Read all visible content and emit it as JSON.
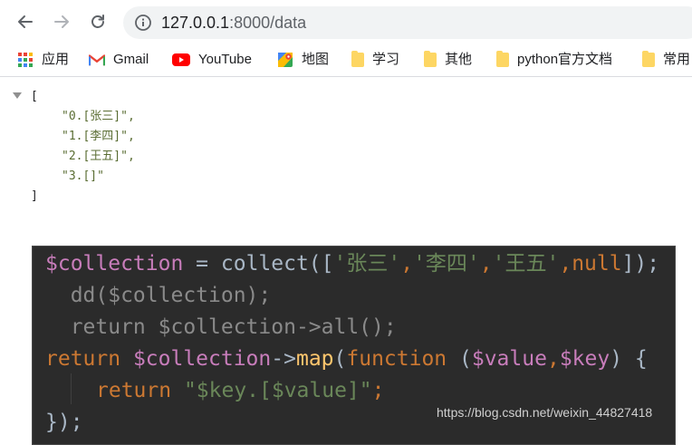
{
  "browser": {
    "url_host": "127.0.0.1",
    "url_rest": ":8000/data",
    "icons": {
      "back": "back-arrow-icon",
      "forward": "forward-arrow-icon",
      "reload": "reload-icon",
      "info": "info-icon"
    }
  },
  "bookmarks": [
    {
      "label": "应用",
      "icon": "apps-grid-icon"
    },
    {
      "label": "Gmail",
      "icon": "gmail-icon"
    },
    {
      "label": "YouTube",
      "icon": "youtube-icon"
    },
    {
      "label": "地图",
      "icon": "maps-icon"
    },
    {
      "label": "学习",
      "icon": "folder-icon"
    },
    {
      "label": "其他",
      "icon": "folder-icon"
    },
    {
      "label": "python官方文档",
      "icon": "folder-icon"
    },
    {
      "label": "常用",
      "icon": "folder-icon"
    }
  ],
  "json_view": {
    "open": "[",
    "items": [
      "\"0.[张三]\",",
      "\"1.[李四]\",",
      "\"2.[王五]\",",
      "\"3.[]\""
    ],
    "close": "]"
  },
  "code": {
    "line1": {
      "var": "$collection",
      "eq": " = ",
      "call": "collect([",
      "s1": "'张三'",
      "c1": ",",
      "s2": "'李四'",
      "c2": ",",
      "s3": "'王五'",
      "c3": ",",
      "null": "null",
      "end": "]);"
    },
    "line2": "  dd($collection);",
    "line3": "  return $collection->all();",
    "line4": {
      "kw": "return ",
      "var": "$collection",
      "arrow": "->",
      "fn": "map",
      "paren": "(",
      "kw2": "function",
      "sp": " (",
      "v1": "$value",
      "comma": ",",
      "v2": "$key",
      "rest": ") {"
    },
    "line5": {
      "kw": "return ",
      "str": "\"$key.[$value]\"",
      "semi": ";"
    },
    "line6": "});"
  },
  "watermark": "https://blog.csdn.net/weixin_44827418"
}
